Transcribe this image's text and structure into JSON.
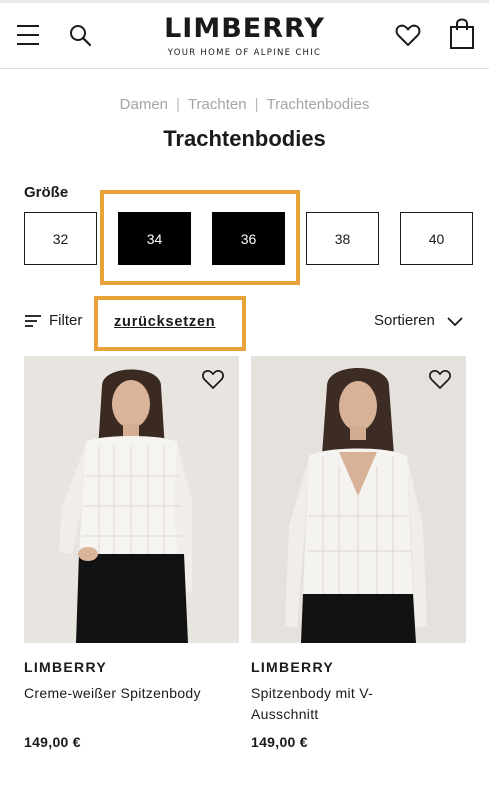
{
  "header": {
    "logo": "LIMBERRY",
    "tagline": "YOUR HOME OF ALPINE CHIC",
    "icons": [
      "menu-icon",
      "search-icon",
      "heart-icon",
      "shopping-bag-icon"
    ]
  },
  "breadcrumb": [
    "Damen",
    "Trachten",
    "Trachtenbodies"
  ],
  "page_title": "Trachtenbodies",
  "size_filter": {
    "label": "Größe",
    "options": [
      {
        "label": "32",
        "selected": false
      },
      {
        "label": "34",
        "selected": true
      },
      {
        "label": "36",
        "selected": true
      },
      {
        "label": "38",
        "selected": false
      },
      {
        "label": "40",
        "selected": false
      }
    ]
  },
  "toolbar": {
    "filter_label": "Filter",
    "reset_label": "zurücksetzen",
    "sort_label": "Sortieren"
  },
  "products": [
    {
      "brand": "LIMBERRY",
      "name": "Creme-weißer Spitzenbody",
      "price": "149,00 €"
    },
    {
      "brand": "LIMBERRY",
      "name": "Spitzenbody mit V-Ausschnitt",
      "price": "149,00 €"
    }
  ],
  "colors": {
    "highlight": "#e8a43b",
    "selected_size_bg": "#000000",
    "breadcrumb_text": "#a4a4a4"
  }
}
